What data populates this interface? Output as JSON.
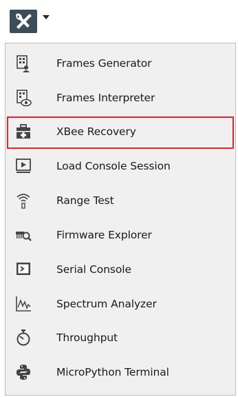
{
  "toolbar": {
    "button_icon": "tools-icon",
    "dropdown_icon": "caret-down-icon",
    "button_color": "#3e4c58"
  },
  "menu": {
    "highlight_color": "#e8232a",
    "items": [
      {
        "label": "Frames Generator",
        "icon": "frames-generator-icon"
      },
      {
        "label": "Frames Interpreter",
        "icon": "frames-interpreter-icon"
      },
      {
        "label": "XBee Recovery",
        "icon": "xbee-recovery-icon",
        "highlighted": true
      },
      {
        "label": "Load Console Session",
        "icon": "load-console-session-icon"
      },
      {
        "label": "Range Test",
        "icon": "range-test-icon"
      },
      {
        "label": "Firmware Explorer",
        "icon": "firmware-explorer-icon"
      },
      {
        "label": "Serial Console",
        "icon": "serial-console-icon"
      },
      {
        "label": "Spectrum Analyzer",
        "icon": "spectrum-analyzer-icon"
      },
      {
        "label": "Throughput",
        "icon": "throughput-icon"
      },
      {
        "label": "MicroPython Terminal",
        "icon": "micropython-terminal-icon"
      }
    ]
  }
}
